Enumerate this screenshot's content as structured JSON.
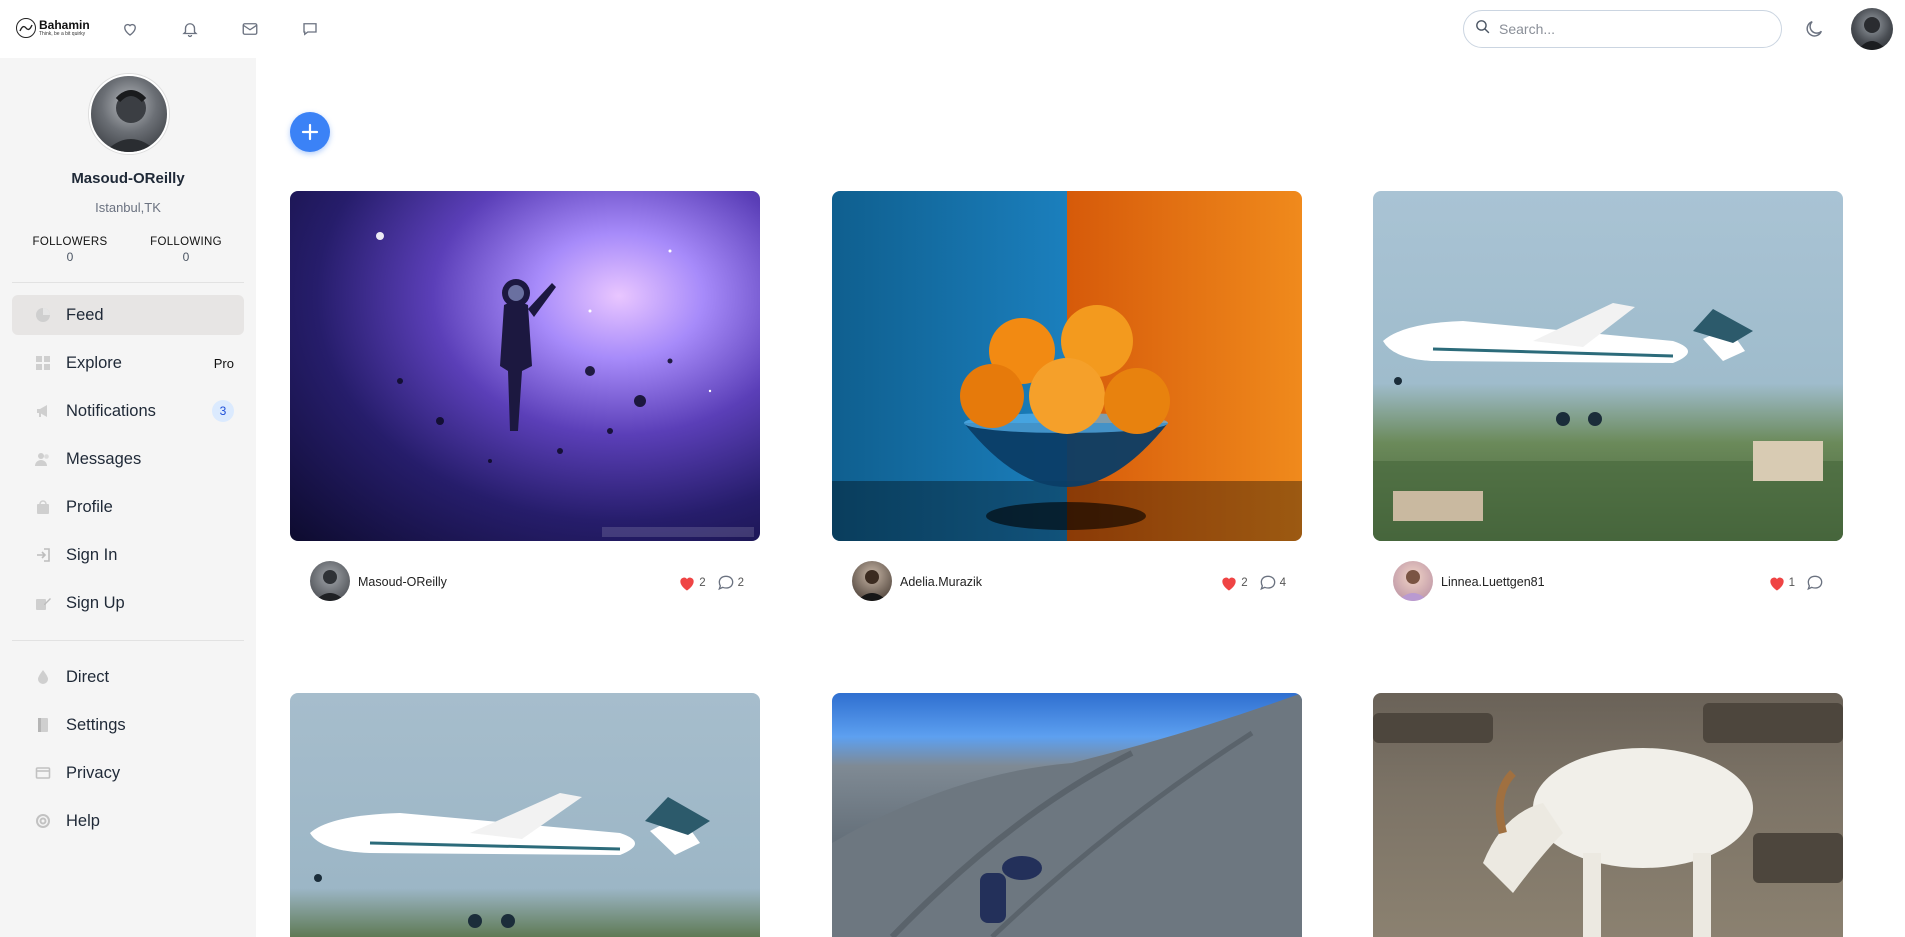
{
  "app": {
    "logo_name": "Bahamin",
    "logo_tagline": "Think, be a bit quirky"
  },
  "topbar": {
    "icons": [
      "heart-icon",
      "bell-icon",
      "mail-icon",
      "chat-icon"
    ],
    "search_placeholder": "Search...",
    "theme_toggle": "moon-icon"
  },
  "profile": {
    "name": "Masoud-OReilly",
    "location": "Istanbul,TK",
    "followers_label": "FOLLOWERS",
    "followers_count": "0",
    "following_label": "FOLLOWING",
    "following_count": "0"
  },
  "nav": {
    "items": [
      {
        "label": "Feed",
        "icon": "feed-icon"
      },
      {
        "label": "Explore",
        "icon": "grid-icon",
        "badge": "Pro"
      },
      {
        "label": "Notifications",
        "icon": "megaphone-icon",
        "count": "3"
      },
      {
        "label": "Messages",
        "icon": "users-icon"
      },
      {
        "label": "Profile",
        "icon": "bag-icon"
      },
      {
        "label": "Sign In",
        "icon": "sign-in-icon"
      },
      {
        "label": "Sign Up",
        "icon": "sign-up-icon"
      }
    ],
    "secondary": [
      {
        "label": "Direct",
        "icon": "drop-icon"
      },
      {
        "label": "Settings",
        "icon": "book-icon"
      },
      {
        "label": "Privacy",
        "icon": "window-icon"
      },
      {
        "label": "Help",
        "icon": "lifebuoy-icon"
      }
    ]
  },
  "feed": {
    "add_label": "+",
    "posts": [
      {
        "user": "Masoud-OReilly",
        "likes": "2",
        "comments": "2",
        "image": "astronaut in space nebula"
      },
      {
        "user": "Adelia.Murazik",
        "likes": "2",
        "comments": "4",
        "image": "bowl of oranges on blue and orange background"
      },
      {
        "user": "Linnea.Luettgen81",
        "likes": "1",
        "comments": "",
        "image": "private jet taking off"
      },
      {
        "user": "",
        "likes": "",
        "comments": "",
        "image": "private jet in flight"
      },
      {
        "user": "",
        "likes": "",
        "comments": "",
        "image": "person climbing rock slope"
      },
      {
        "user": "",
        "likes": "",
        "comments": "",
        "image": "white goat grazing"
      }
    ]
  },
  "colors": {
    "accent": "#3b82f6",
    "heart": "#ef4444",
    "sidebar_bg": "#f5f5f5",
    "active_nav": "#e7e5e4"
  }
}
